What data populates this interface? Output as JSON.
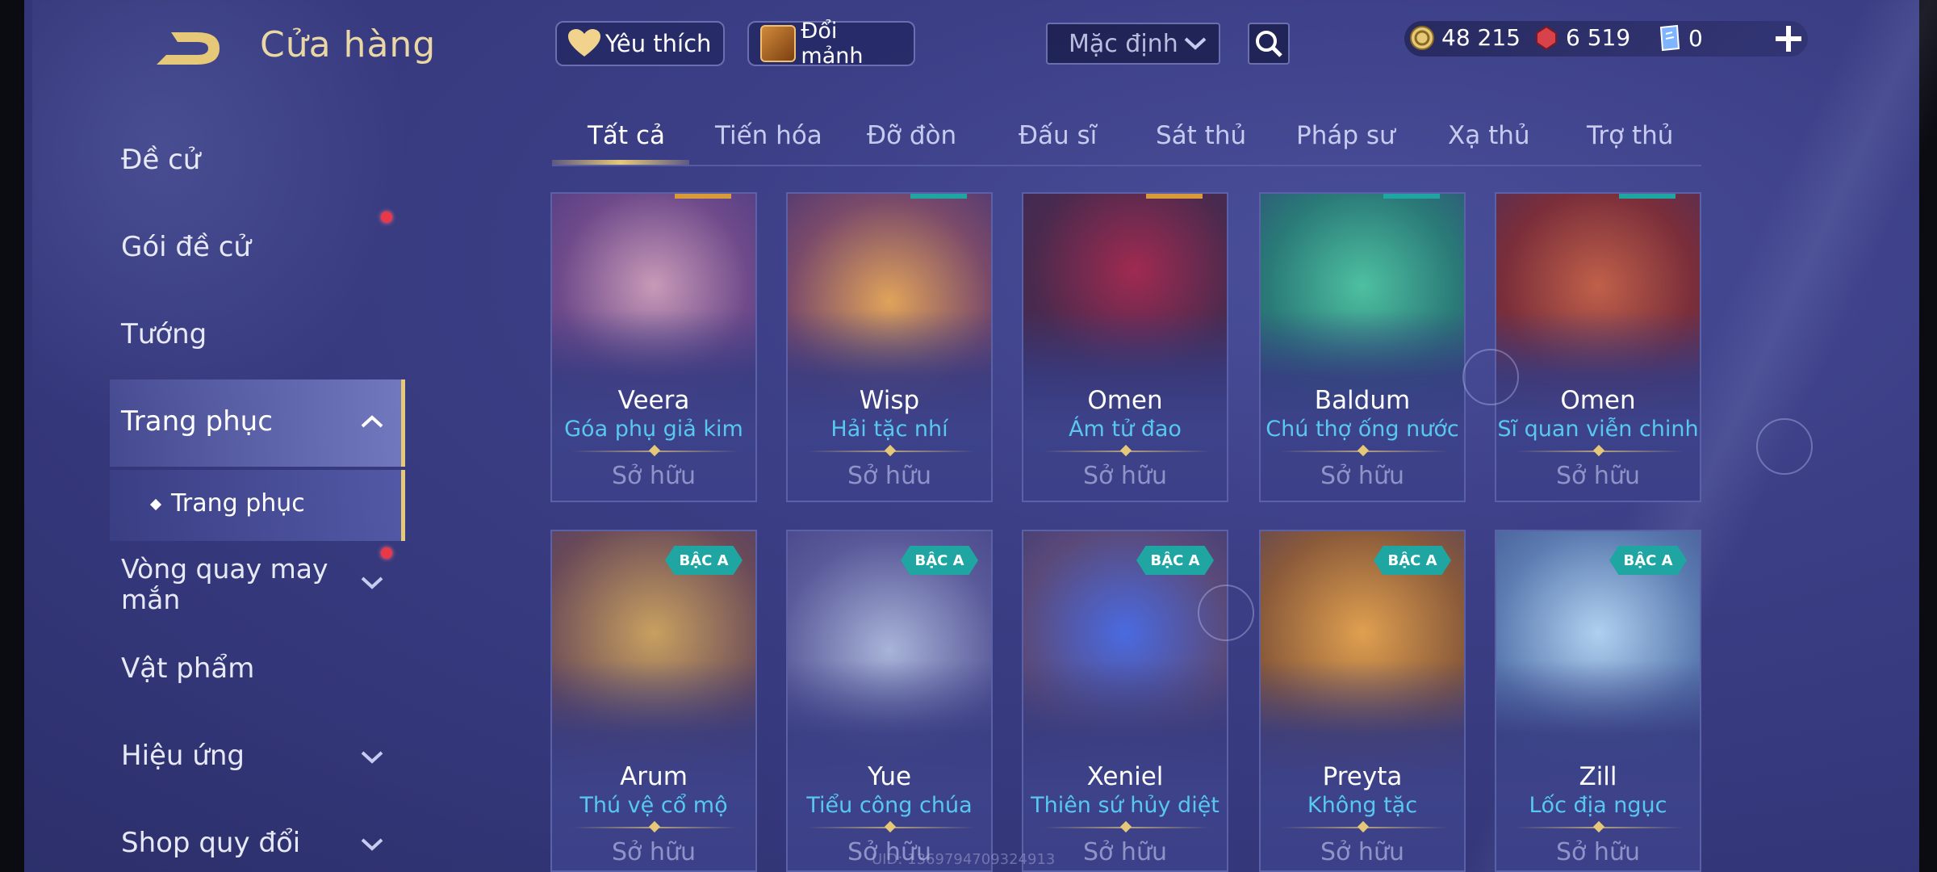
{
  "header": {
    "title": "Cửa hàng",
    "favorites_label": "Yêu thích",
    "shards_label": "Đổi mảnh",
    "sort_select": {
      "value": "Mặc định"
    },
    "currencies": [
      {
        "name": "gold",
        "value": "48 215",
        "color": "#e6c879"
      },
      {
        "name": "ruby",
        "value": "6 519",
        "color": "#d8424a"
      },
      {
        "name": "voucher",
        "value": "0",
        "color": "#7fb4ff"
      }
    ]
  },
  "sidebar": {
    "items": [
      {
        "label": "Đề cử",
        "dot": false,
        "chevron": null
      },
      {
        "label": "Gói đề cử",
        "dot": true,
        "chevron": null
      },
      {
        "label": "Tướng",
        "dot": false,
        "chevron": null
      },
      {
        "label": "Trang phục",
        "dot": false,
        "chevron": "up",
        "active": true
      },
      {
        "label": "Vòng quay may mắn",
        "dot": true,
        "chevron": "down"
      },
      {
        "label": "Vật phẩm",
        "dot": false,
        "chevron": null
      },
      {
        "label": "Hiệu ứng",
        "dot": false,
        "chevron": "down"
      },
      {
        "label": "Shop quy đổi",
        "dot": false,
        "chevron": "down"
      }
    ],
    "sub_item": {
      "label": "Trang phục",
      "active": true
    }
  },
  "tabs": [
    {
      "label": "Tất cả",
      "active": true
    },
    {
      "label": "Tiến hóa"
    },
    {
      "label": "Đỡ đòn"
    },
    {
      "label": "Đấu sĩ"
    },
    {
      "label": "Sát thủ"
    },
    {
      "label": "Pháp sư"
    },
    {
      "label": "Xạ thủ"
    },
    {
      "label": "Trợ thủ"
    }
  ],
  "cards": [
    {
      "hero": "Veera",
      "skin": "Góa phụ giả kim",
      "status": "Sở hữu",
      "rank": null
    },
    {
      "hero": "Wisp",
      "skin": "Hải tặc nhí",
      "status": "Sở hữu",
      "rank": null
    },
    {
      "hero": "Omen",
      "skin": "Ám tử đao",
      "status": "Sở hữu",
      "rank": null
    },
    {
      "hero": "Baldum",
      "skin": "Chú thợ ống nước",
      "status": "Sở hữu",
      "rank": null
    },
    {
      "hero": "Omen",
      "skin": "Sĩ quan viễn chinh",
      "status": "Sở hữu",
      "rank": null
    },
    {
      "hero": "Arum",
      "skin": "Thú vệ cổ mộ",
      "status": "Sở hữu",
      "rank": "BẬC A"
    },
    {
      "hero": "Yue",
      "skin": "Tiểu công chúa",
      "status": "Sở hữu",
      "rank": "BẬC A"
    },
    {
      "hero": "Xeniel",
      "skin": "Thiên sứ hủy diệt",
      "status": "Sở hữu",
      "rank": "BẬC A"
    },
    {
      "hero": "Preyta",
      "skin": "Không tặc",
      "status": "Sở hữu",
      "rank": "BẬC A"
    },
    {
      "hero": "Zill",
      "skin": "Lốc địa ngục",
      "status": "Sở hữu",
      "rank": "BẬC A"
    }
  ],
  "footer": {
    "uid": "UID: 1369794709324913"
  },
  "colors": {
    "accent_gold": "#e6c879",
    "skin_name": "#58c8f0",
    "owned_text": "#8e93c8",
    "rank_badge": "#1fa6a2"
  }
}
